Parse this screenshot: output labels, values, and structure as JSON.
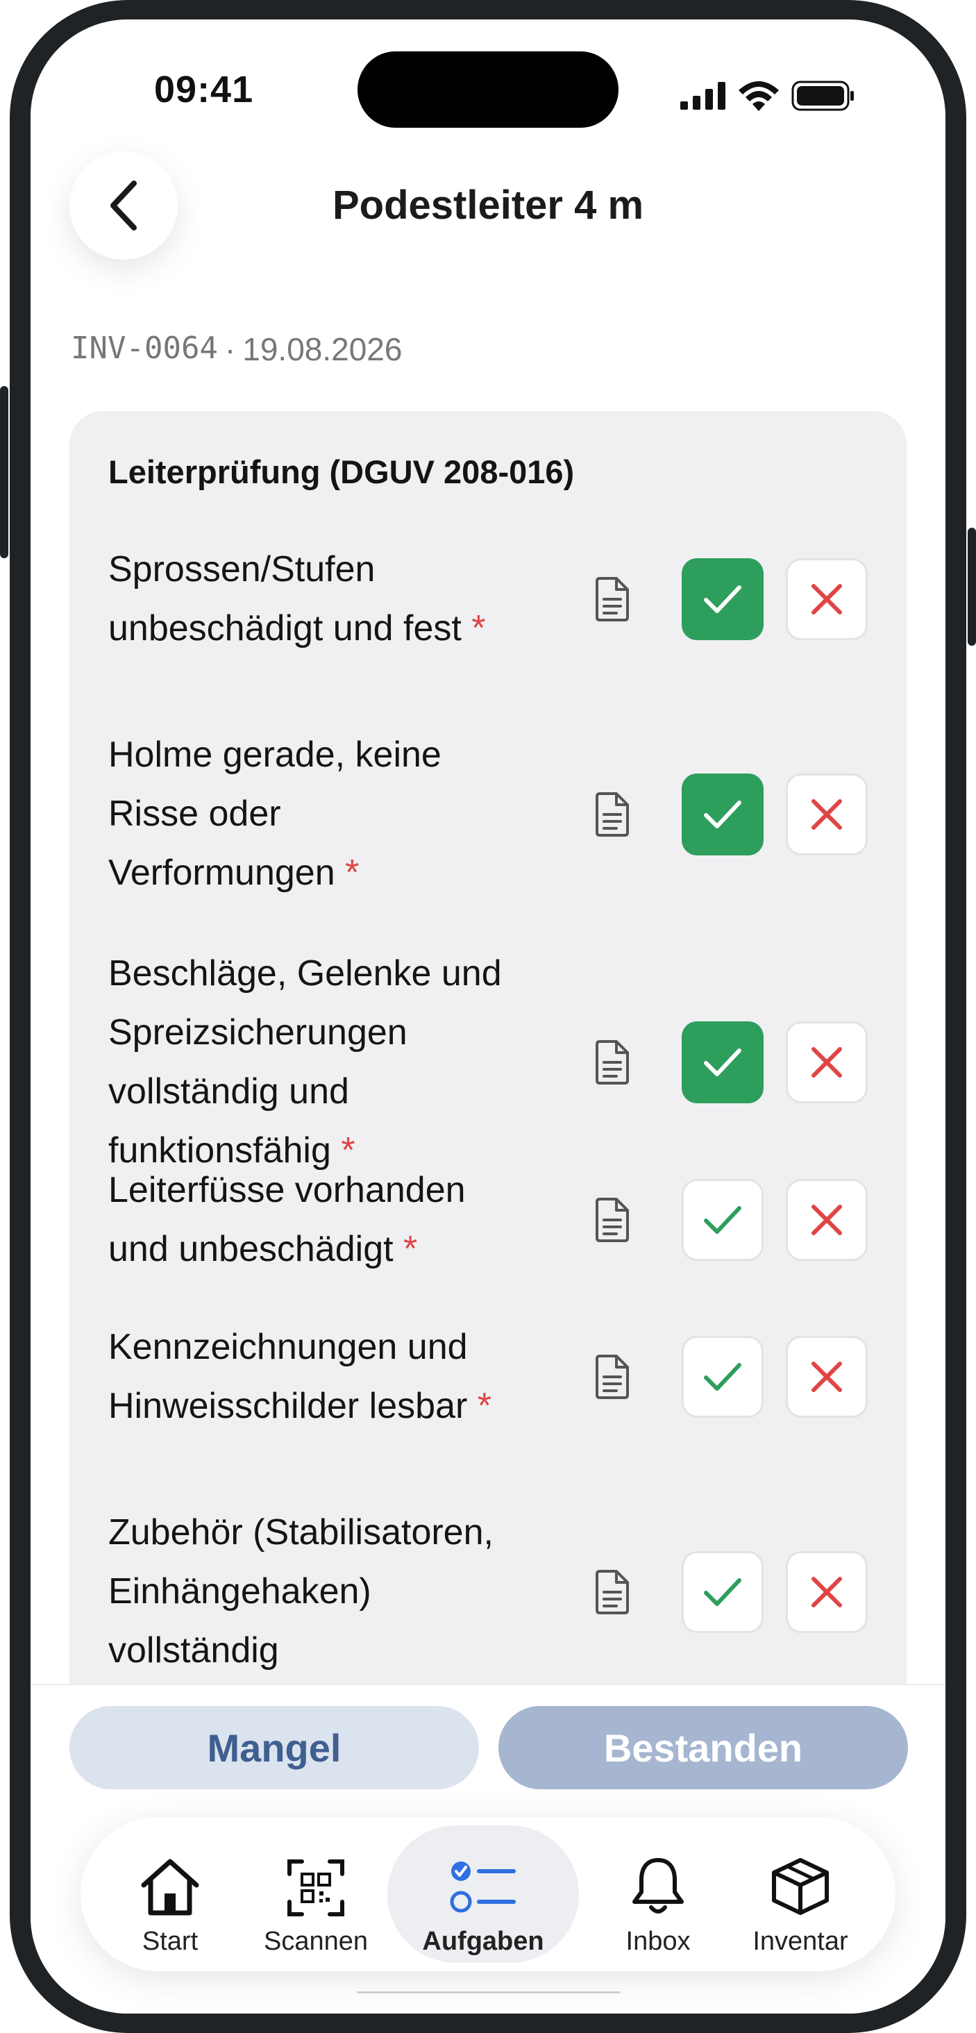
{
  "status": {
    "time": "09:41"
  },
  "header": {
    "title": "Podestleiter 4 m"
  },
  "meta": {
    "inventory_id": "INV-0064",
    "separator": "·",
    "date": "19.08.2026"
  },
  "checklist": {
    "title": "Leiterprüfung (DGUV 208-016)",
    "required_mark": "*",
    "items": [
      {
        "lines": [
          "Sprossen/Stufen",
          "unbeschädigt und fest"
        ],
        "required": true,
        "state": "ok"
      },
      {
        "lines": [
          "Holme gerade, keine",
          "Risse oder",
          "Verformungen"
        ],
        "required": true,
        "state": "ok"
      },
      {
        "lines": [
          "Beschläge, Gelenke und",
          "Spreizsicherungen",
          "vollständig und",
          "funktionsfähig"
        ],
        "required": true,
        "state": "ok"
      },
      {
        "lines": [
          "Leiterfüsse vorhanden",
          "und unbeschädigt"
        ],
        "required": true,
        "state": "none"
      },
      {
        "lines": [
          "Kennzeichnungen und",
          "Hinweisschilder lesbar"
        ],
        "required": true,
        "state": "none"
      },
      {
        "lines": [
          "Zubehör (Stabilisatoren,",
          "Einhängehaken)",
          "vollständig"
        ],
        "required": false,
        "state": "none"
      }
    ]
  },
  "actions": {
    "defect_label": "Mangel",
    "pass_label": "Bestanden"
  },
  "tabs": [
    {
      "id": "start",
      "label": "Start",
      "icon": "home-icon"
    },
    {
      "id": "scan",
      "label": "Scannen",
      "icon": "qr-scan-icon"
    },
    {
      "id": "tasks",
      "label": "Aufgaben",
      "icon": "checklist-icon",
      "active": true
    },
    {
      "id": "inbox",
      "label": "Inbox",
      "icon": "bell-icon"
    },
    {
      "id": "inventory",
      "label": "Inventar",
      "icon": "box-icon"
    }
  ],
  "colors": {
    "accent_green": "#2e9e5d",
    "reject_red": "#e04545",
    "tab_blue": "#2f6fe0"
  }
}
